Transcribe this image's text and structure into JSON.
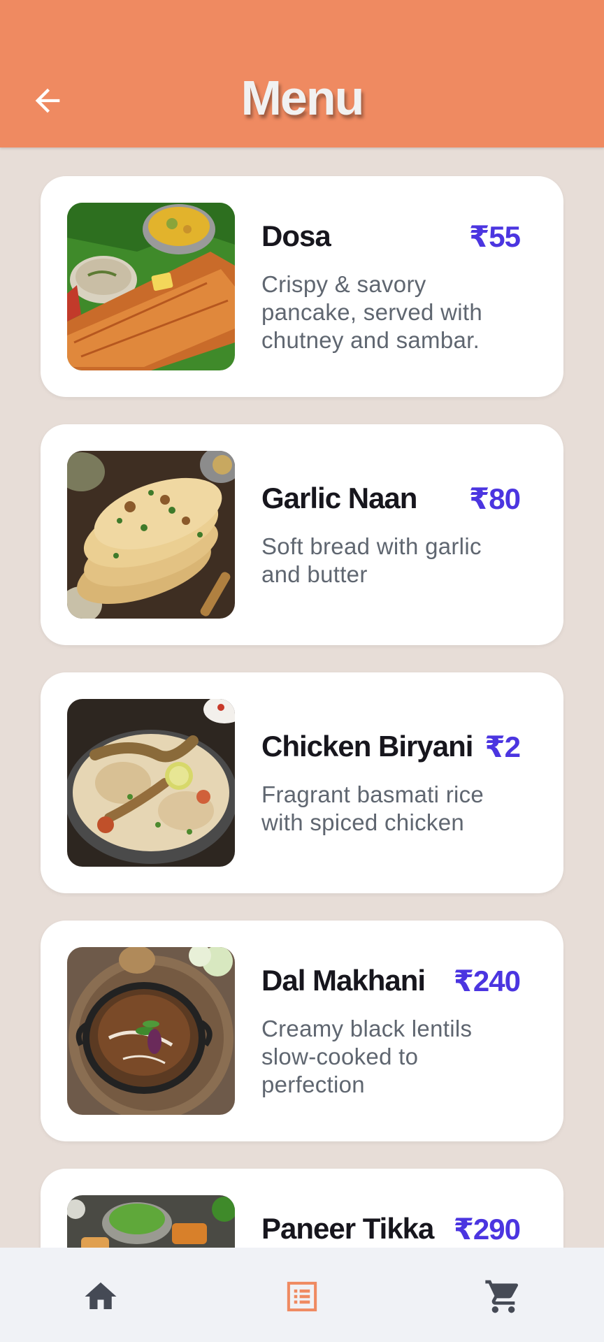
{
  "header": {
    "title": "Menu"
  },
  "colors": {
    "header": "#ef8a61",
    "price": "#4b35e0",
    "background": "#e7ddd7",
    "nav_active": "#ef8a61",
    "nav_inactive": "#454a55"
  },
  "menu": {
    "items": [
      {
        "name": "Dosa",
        "price": "₹55",
        "description": "Crispy & savory pancake, served with chutney and sambar.",
        "image_icon": "dosa-image"
      },
      {
        "name": "Garlic Naan",
        "price": "₹80",
        "description": "Soft bread with garlic and butter",
        "image_icon": "garlic-naan-image"
      },
      {
        "name": "Chicken Biryani",
        "price": "₹2",
        "description": "Fragrant basmati rice with spiced chicken",
        "image_icon": "chicken-biryani-image"
      },
      {
        "name": "Dal Makhani",
        "price": "₹240",
        "description": "Creamy black lentils slow-cooked to perfection",
        "image_icon": "dal-makhani-image"
      },
      {
        "name": "Paneer Tikka",
        "price": "₹290",
        "description": "",
        "image_icon": "paneer-tikka-image"
      }
    ]
  },
  "nav": {
    "items": [
      {
        "icon": "home-icon",
        "active": false
      },
      {
        "icon": "menu-list-icon",
        "active": true
      },
      {
        "icon": "cart-icon",
        "active": false
      }
    ]
  }
}
